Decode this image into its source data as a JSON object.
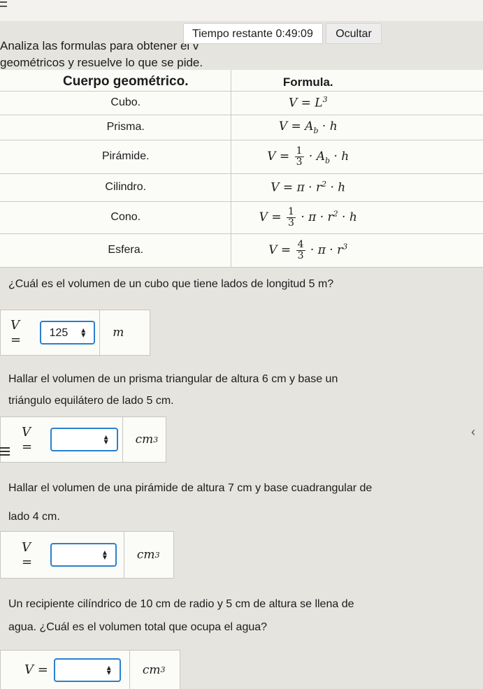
{
  "header": {
    "intro_line1": "Analiza las formulas para obtener el v",
    "intro_line2": "geométricos y resuelve lo que se pide.",
    "timer_label": "Tiempo restante",
    "timer_value": "0:49:09",
    "hide_label": "Ocultar"
  },
  "table": {
    "col1": "Cuerpo geométrico.",
    "col2": "Formula.",
    "rows": [
      {
        "name": "Cubo."
      },
      {
        "name": "Prisma."
      },
      {
        "name": "Pirámide."
      },
      {
        "name": "Cilindro."
      },
      {
        "name": "Cono."
      },
      {
        "name": "Esfera."
      }
    ],
    "frac_one": "1",
    "frac_three": "3",
    "frac_four": "4"
  },
  "questions": [
    {
      "text": "¿Cuál es el volumen de un cubo que tiene lados de longitud 5 m?",
      "value": "125",
      "unit": "m",
      "unit_exp": ""
    },
    {
      "text": "Hallar el volumen de un prisma triangular de altura 6 cm y base un",
      "text2": "triángulo equilátero de lado 5 cm.",
      "value": "",
      "unit": "cm",
      "unit_exp": "3"
    },
    {
      "text": "Hallar el volumen de una pirámide de altura 7 cm y base cuadrangular de",
      "text2": "lado 4 cm.",
      "value": "",
      "unit": "cm",
      "unit_exp": "3"
    },
    {
      "text": "Un recipiente cilíndrico de 10 cm de radio y 5 cm de altura se llena de",
      "text2": "agua. ¿Cuál es el volumen total que ocupa el agua?",
      "value": "",
      "unit": "cm",
      "unit_exp": "3"
    }
  ],
  "v_label": "V =",
  "icons": {
    "stepper": "stepper-arrows-icon",
    "menu": "hamburger-menu-icon",
    "chevron": "chevron-left-icon"
  }
}
